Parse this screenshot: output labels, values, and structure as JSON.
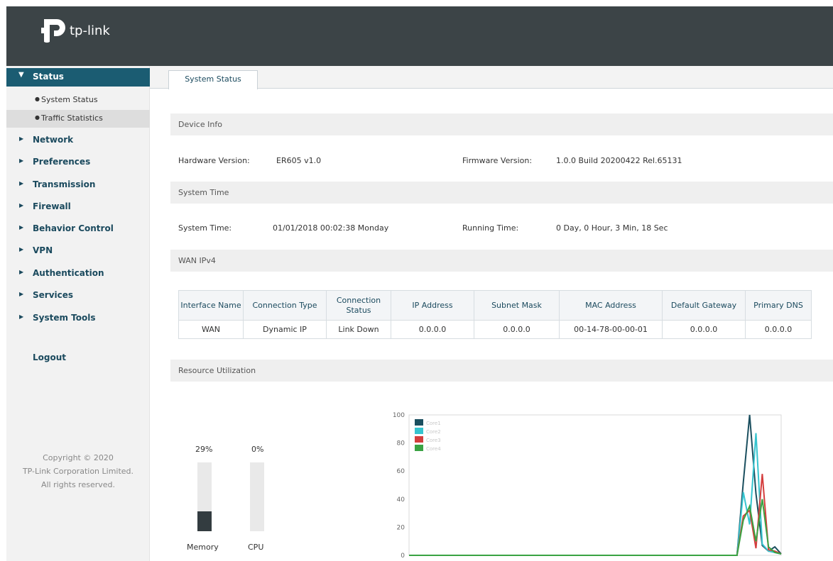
{
  "header": {
    "logo_text": "tp-link",
    "logo_icon": "tp-link-logo-icon"
  },
  "sidebar": {
    "status": {
      "label": "Status",
      "icon": "triangle-down-icon"
    },
    "sub_items": [
      {
        "label": "System Status",
        "icon": "bullet-icon"
      },
      {
        "label": "Traffic Statistics",
        "icon": "bullet-icon"
      }
    ],
    "menu_items": [
      {
        "label": "Network",
        "icon": "triangle-right-icon"
      },
      {
        "label": "Preferences",
        "icon": "triangle-right-icon"
      },
      {
        "label": "Transmission",
        "icon": "triangle-right-icon"
      },
      {
        "label": "Firewall",
        "icon": "triangle-right-icon"
      },
      {
        "label": "Behavior Control",
        "icon": "triangle-right-icon"
      },
      {
        "label": "VPN",
        "icon": "triangle-right-icon"
      },
      {
        "label": "Authentication",
        "icon": "triangle-right-icon"
      },
      {
        "label": "Services",
        "icon": "triangle-right-icon"
      },
      {
        "label": "System Tools",
        "icon": "triangle-right-icon"
      }
    ],
    "logout": "Logout",
    "copyright": [
      "Copyright © 2020",
      "TP-Link Corporation Limited.",
      "All rights reserved."
    ]
  },
  "tabs": [
    {
      "label": "System Status"
    }
  ],
  "device_info": {
    "title": "Device Info",
    "hardware_label": "Hardware Version:",
    "hardware_value": "ER605 v1.0",
    "firmware_label": "Firmware Version:",
    "firmware_value": "1.0.0 Build 20200422 Rel.65131"
  },
  "system_time": {
    "title": "System Time",
    "time_label": "System Time:",
    "time_value": "01/01/2018 00:02:38 Monday",
    "running_label": "Running Time:",
    "running_value": "0 Day, 0 Hour, 3 Min, 18 Sec"
  },
  "wan": {
    "title": "WAN IPv4",
    "columns": [
      "Interface Name",
      "Connection Type",
      "Connection Status",
      "IP Address",
      "Subnet Mask",
      "MAC Address",
      "Default Gateway",
      "Primary DNS"
    ],
    "rows": [
      [
        "WAN",
        "Dynamic IP",
        "Link Down",
        "0.0.0.0",
        "0.0.0.0",
        "00-14-78-00-00-01",
        "0.0.0.0",
        "0.0.0.0"
      ]
    ]
  },
  "resource": {
    "title": "Resource Utilization",
    "memory": {
      "label": "Memory",
      "percent_text": "29%",
      "value": 29
    },
    "cpu": {
      "label": "CPU",
      "percent_text": "0%",
      "value": 0
    }
  },
  "chart_data": {
    "type": "line",
    "ylim": [
      0,
      100
    ],
    "y_ticks": [
      "0",
      "20",
      "40",
      "60",
      "80",
      "100"
    ],
    "legend_position": "top-left",
    "x": [
      0,
      1,
      2,
      3,
      4,
      5,
      6,
      7,
      8,
      9,
      10,
      11,
      12,
      13,
      14,
      15,
      16,
      17,
      18,
      19,
      20,
      21,
      22,
      23,
      24,
      25,
      26,
      27,
      28,
      29,
      30,
      31,
      32,
      33,
      34,
      35,
      36,
      37,
      38,
      39,
      40,
      41,
      42,
      43,
      44,
      45,
      46,
      47,
      48,
      49,
      50,
      51,
      52,
      53,
      54,
      55,
      56,
      57,
      58,
      59
    ],
    "series": [
      {
        "name": "Core1",
        "color": "#1b4f5f",
        "values": [
          0,
          0,
          0,
          0,
          0,
          0,
          0,
          0,
          0,
          0,
          0,
          0,
          0,
          0,
          0,
          0,
          0,
          0,
          0,
          0,
          0,
          0,
          0,
          0,
          0,
          0,
          0,
          0,
          0,
          0,
          0,
          0,
          0,
          0,
          0,
          0,
          0,
          0,
          0,
          0,
          0,
          0,
          0,
          0,
          0,
          0,
          0,
          0,
          0,
          0,
          0,
          0,
          0,
          52,
          100,
          44,
          7,
          3,
          6,
          1
        ]
      },
      {
        "name": "Core2",
        "color": "#36c4cf",
        "values": [
          0,
          0,
          0,
          0,
          0,
          0,
          0,
          0,
          0,
          0,
          0,
          0,
          0,
          0,
          0,
          0,
          0,
          0,
          0,
          0,
          0,
          0,
          0,
          0,
          0,
          0,
          0,
          0,
          0,
          0,
          0,
          0,
          0,
          0,
          0,
          0,
          0,
          0,
          0,
          0,
          0,
          0,
          0,
          0,
          0,
          0,
          0,
          0,
          0,
          0,
          0,
          0,
          0,
          45,
          22,
          87,
          8,
          3,
          2,
          1
        ]
      },
      {
        "name": "Core3",
        "color": "#d43e3e",
        "values": [
          0,
          0,
          0,
          0,
          0,
          0,
          0,
          0,
          0,
          0,
          0,
          0,
          0,
          0,
          0,
          0,
          0,
          0,
          0,
          0,
          0,
          0,
          0,
          0,
          0,
          0,
          0,
          0,
          0,
          0,
          0,
          0,
          0,
          0,
          0,
          0,
          0,
          0,
          0,
          0,
          0,
          0,
          0,
          0,
          0,
          0,
          0,
          0,
          0,
          0,
          0,
          0,
          0,
          28,
          32,
          5,
          58,
          4,
          3,
          1
        ]
      },
      {
        "name": "Core4",
        "color": "#3aa343",
        "values": [
          0,
          0,
          0,
          0,
          0,
          0,
          0,
          0,
          0,
          0,
          0,
          0,
          0,
          0,
          0,
          0,
          0,
          0,
          0,
          0,
          0,
          0,
          0,
          0,
          0,
          0,
          0,
          0,
          0,
          0,
          0,
          0,
          0,
          0,
          0,
          0,
          0,
          0,
          0,
          0,
          0,
          0,
          0,
          0,
          0,
          0,
          0,
          0,
          0,
          0,
          0,
          0,
          0,
          25,
          35,
          10,
          40,
          6,
          2,
          1
        ]
      }
    ]
  }
}
